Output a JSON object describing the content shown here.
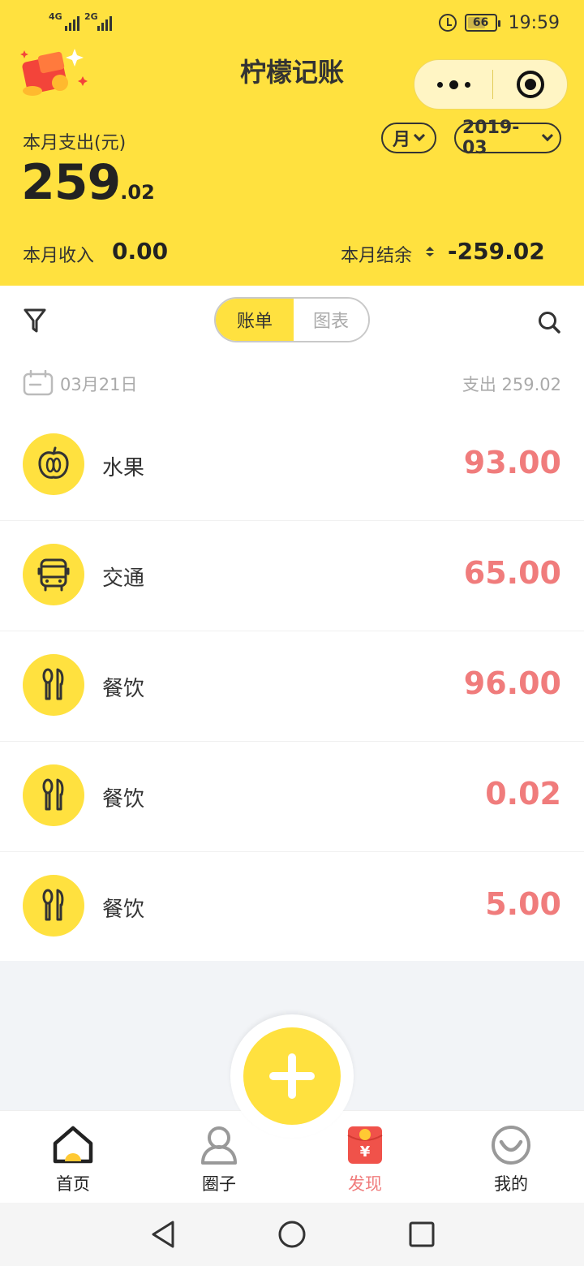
{
  "status_bar": {
    "signal_1": "4G",
    "signal_2": "2G",
    "battery": "66",
    "battery_level": 0.66,
    "time": "19:59"
  },
  "header": {
    "app_title": "柠檬记账",
    "month_expense_label": "本月支出(元)",
    "month_expense_int": "259",
    "month_expense_dec": ".02",
    "period_filter": "月",
    "period_value": "2019-03",
    "income_label": "本月收入",
    "income_value": "0.00",
    "balance_label": "本月结余",
    "balance_value": "-259.02"
  },
  "toolbar": {
    "tab_bill": "账单",
    "tab_chart": "图表",
    "active_tab": "账单"
  },
  "day": {
    "date": "03月21日",
    "total": "支出 259.02"
  },
  "transactions": [
    {
      "category": "水果",
      "amount": "93.00",
      "icon": "fruit-icon"
    },
    {
      "category": "交通",
      "amount": "65.00",
      "icon": "bus-icon"
    },
    {
      "category": "餐饮",
      "amount": "96.00",
      "icon": "utensils-icon"
    },
    {
      "category": "餐饮",
      "amount": "0.02",
      "icon": "utensils-icon"
    },
    {
      "category": "餐饮",
      "amount": "5.00",
      "icon": "utensils-icon"
    }
  ],
  "tabbar": {
    "home": "首页",
    "circle": "圈子",
    "discover": "发现",
    "mine": "我的",
    "active": "发现"
  },
  "colors": {
    "brand_yellow": "#ffe13f",
    "amount_red": "#f07c7c",
    "muted_gray": "#aaaaaa"
  }
}
